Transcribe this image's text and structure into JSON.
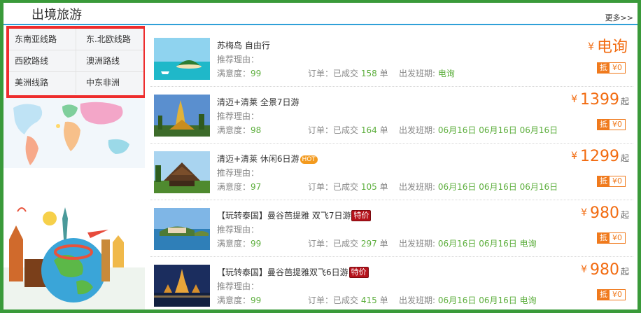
{
  "header": {
    "title": "出境旅游",
    "more_label": "更多>>"
  },
  "routes": [
    "东南亚线路",
    "东.北欧线路",
    "西欧路线",
    "澳洲路线",
    "美洲线路",
    "中东非洲"
  ],
  "products": [
    {
      "name": "苏梅岛 自由行",
      "badge": "",
      "reason_label": "推荐理由：",
      "satisfaction_label": "满意度：",
      "satisfaction": "99",
      "orders_label": "订单：已成交",
      "orders": "158",
      "orders_unit": "单",
      "departure_label": "出发班期:",
      "departure": "电询",
      "currency": "¥",
      "price": "电询",
      "price_suffix": "",
      "coupon_tag": "抵",
      "coupon_value": "¥0"
    },
    {
      "name": "清迈+清莱 全景7日游",
      "badge": "",
      "reason_label": "推荐理由：",
      "satisfaction_label": "满意度：",
      "satisfaction": "98",
      "orders_label": "订单：已成交",
      "orders": "164",
      "orders_unit": "单",
      "departure_label": "出发班期:",
      "departure": "06月16日 06月16日 06月16日",
      "currency": "¥",
      "price": "1399",
      "price_suffix": "起",
      "coupon_tag": "抵",
      "coupon_value": "¥0"
    },
    {
      "name": "清迈+清莱 休闲6日游",
      "badge": "HOT",
      "reason_label": "推荐理由：",
      "satisfaction_label": "满意度：",
      "satisfaction": "97",
      "orders_label": "订单：已成交",
      "orders": "105",
      "orders_unit": "单",
      "departure_label": "出发班期:",
      "departure": "06月16日 06月16日 06月16日",
      "currency": "¥",
      "price": "1299",
      "price_suffix": "起",
      "coupon_tag": "抵",
      "coupon_value": "¥0"
    },
    {
      "name": "【玩转泰国】曼谷芭提雅 双飞7日游",
      "badge": "特价",
      "reason_label": "推荐理由：",
      "satisfaction_label": "满意度：",
      "satisfaction": "99",
      "orders_label": "订单：已成交",
      "orders": "297",
      "orders_unit": "单",
      "departure_label": "出发班期:",
      "departure": "06月16日 06月16日 电询",
      "currency": "¥",
      "price": "980",
      "price_suffix": "起",
      "coupon_tag": "抵",
      "coupon_value": "¥0"
    },
    {
      "name": "【玩转泰国】曼谷芭提雅双飞6日游",
      "badge": "特价",
      "reason_label": "推荐理由：",
      "satisfaction_label": "满意度：",
      "satisfaction": "99",
      "orders_label": "订单：已成交",
      "orders": "415",
      "orders_unit": "单",
      "departure_label": "出发班期:",
      "departure": "06月16日 06月16日 电询",
      "currency": "¥",
      "price": "980",
      "price_suffix": "起",
      "coupon_tag": "抵",
      "coupon_value": "¥0"
    }
  ],
  "colors": {
    "accent_green": "#5cae3c",
    "price_orange": "#f26b10",
    "frame_green": "#3a9a3a",
    "highlight_red": "#ee2d2d",
    "header_line": "#2fa0d8"
  }
}
